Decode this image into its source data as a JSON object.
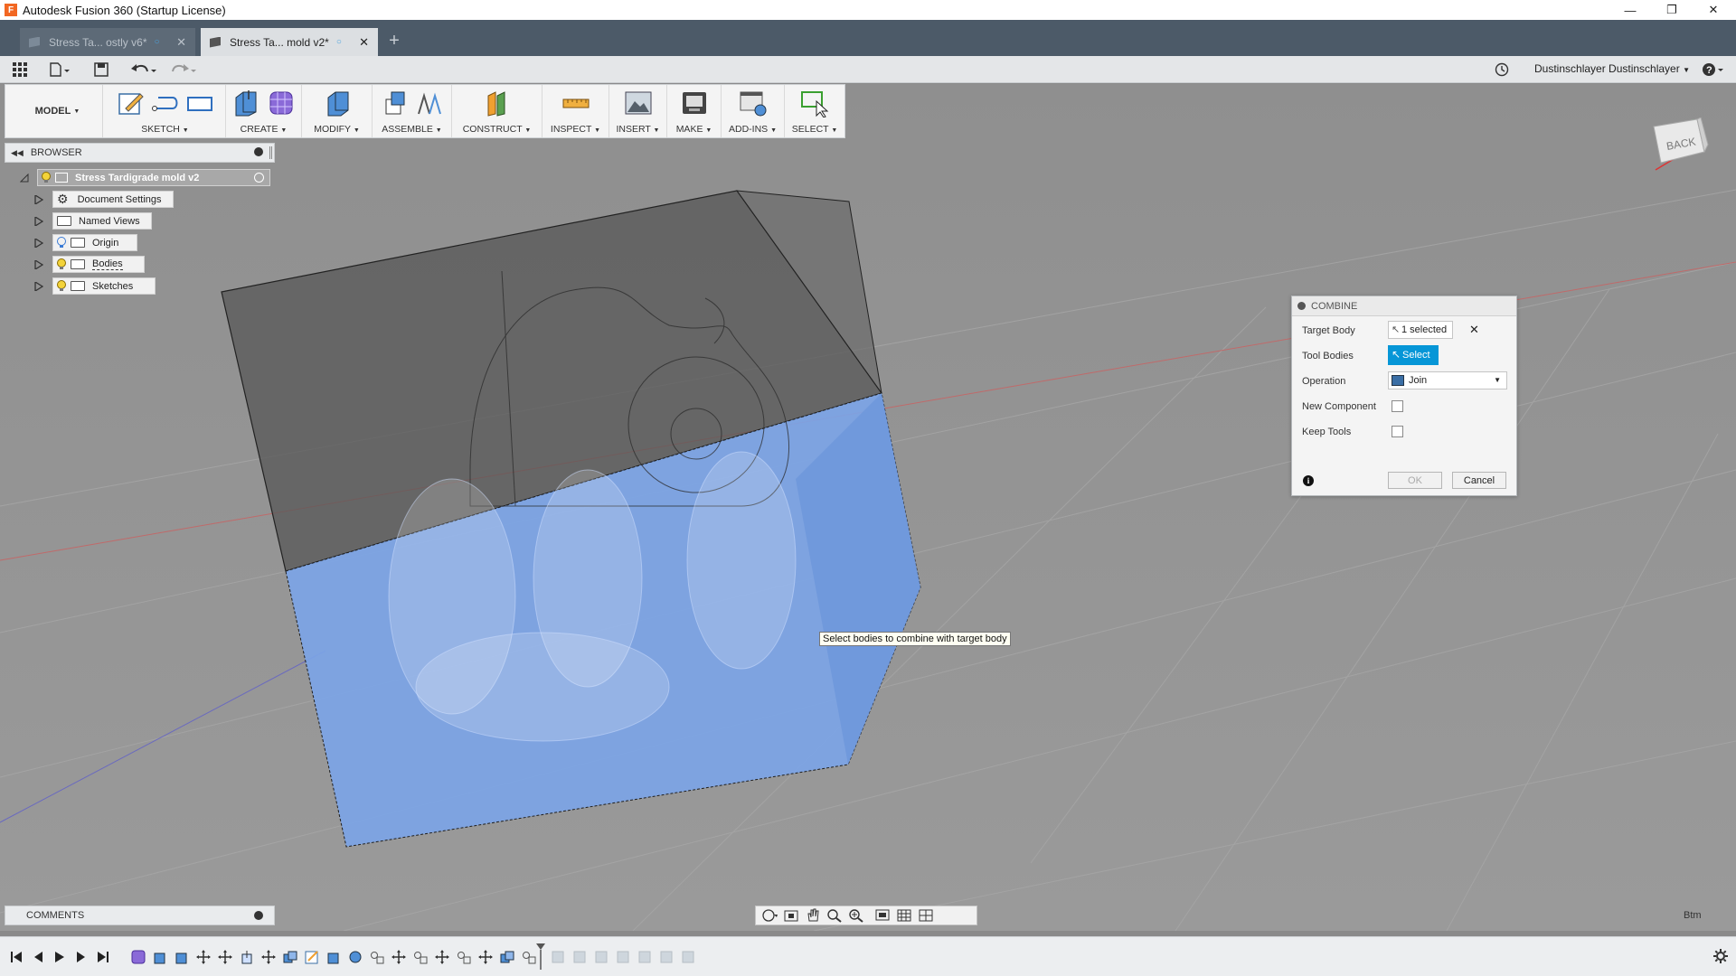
{
  "window": {
    "title": "Autodesk Fusion 360 (Startup License)",
    "app_icon_letter": "F",
    "controls": [
      "minimize",
      "restore",
      "close"
    ]
  },
  "tabs": [
    {
      "label": "Stress Ta... ostly v6*",
      "active": false
    },
    {
      "label": "Stress Ta... mold v2*",
      "active": true
    }
  ],
  "quick_access": {
    "user": "Dustinschlayer Dustinschlayer"
  },
  "ribbon": {
    "workspace": "MODEL",
    "groups": [
      {
        "label": "SKETCH"
      },
      {
        "label": "CREATE"
      },
      {
        "label": "MODIFY"
      },
      {
        "label": "ASSEMBLE"
      },
      {
        "label": "CONSTRUCT"
      },
      {
        "label": "INSPECT"
      },
      {
        "label": "INSERT"
      },
      {
        "label": "MAKE"
      },
      {
        "label": "ADD-INS"
      },
      {
        "label": "SELECT"
      }
    ]
  },
  "browser": {
    "title": "BROWSER",
    "root": "Stress Tardigrade mold v2",
    "items": [
      {
        "label": "Document Settings",
        "icon": "gear-icon"
      },
      {
        "label": "Named Views",
        "icon": "folder-icon"
      },
      {
        "label": "Origin",
        "icon": "folder-icon"
      },
      {
        "label": "Bodies",
        "icon": "folder-icon"
      },
      {
        "label": "Sketches",
        "icon": "folder-icon"
      }
    ]
  },
  "combine_dialog": {
    "title": "COMBINE",
    "target_body_label": "Target Body",
    "target_body_value": "1 selected",
    "tool_bodies_label": "Tool Bodies",
    "tool_bodies_button": "Select",
    "operation_label": "Operation",
    "operation_value": "Join",
    "new_component_label": "New Component",
    "new_component_checked": false,
    "keep_tools_label": "Keep Tools",
    "keep_tools_checked": false,
    "ok_label": "OK",
    "cancel_label": "Cancel"
  },
  "tooltip": "Select bodies to combine with target body",
  "comments": {
    "title": "COMMENTS"
  },
  "viewcube": {
    "face": "BACK"
  },
  "units": "Btm",
  "colors": {
    "accent": "#0696d7",
    "tab_bar": "#4c5a68",
    "body_blue": "#7ca4e6"
  }
}
